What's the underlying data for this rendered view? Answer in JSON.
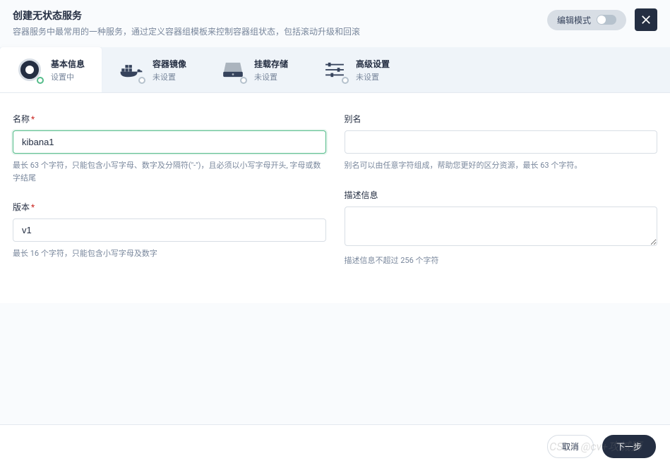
{
  "header": {
    "title": "创建无状态服务",
    "description": "容器服务中最常用的一种服务，通过定义容器组模板来控制容器组状态，包括滚动升级和回滚",
    "edit_mode_label": "编辑模式"
  },
  "tabs": [
    {
      "title": "基本信息",
      "subtitle": "设置中",
      "icon": "basic-info-icon",
      "status": "active"
    },
    {
      "title": "容器镜像",
      "subtitle": "未设置",
      "icon": "docker-icon",
      "status": "unset"
    },
    {
      "title": "挂载存储",
      "subtitle": "未设置",
      "icon": "storage-icon",
      "status": "unset"
    },
    {
      "title": "高级设置",
      "subtitle": "未设置",
      "icon": "advanced-settings-icon",
      "status": "unset"
    }
  ],
  "form": {
    "name": {
      "label": "名称",
      "value": "kibana1",
      "hint": "最长 63 个字符，只能包含小写字母、数字及分隔符(\"-\")，且必须以小写字母开头, 字母或数字结尾",
      "required": true
    },
    "alias": {
      "label": "别名",
      "value": "",
      "hint": "别名可以由任意字符组成，帮助您更好的区分资源，最长 63 个字符。",
      "required": false
    },
    "version": {
      "label": "版本",
      "value": "v1",
      "hint": "最长 16 个字符，只能包含小写字母及数字",
      "required": true
    },
    "description": {
      "label": "描述信息",
      "value": "",
      "hint": "描述信息不超过 256 个字符",
      "required": false
    }
  },
  "footer": {
    "cancel": "取消",
    "next": "下一步"
  },
  "watermark": "CSDN @cv+攻城狮"
}
